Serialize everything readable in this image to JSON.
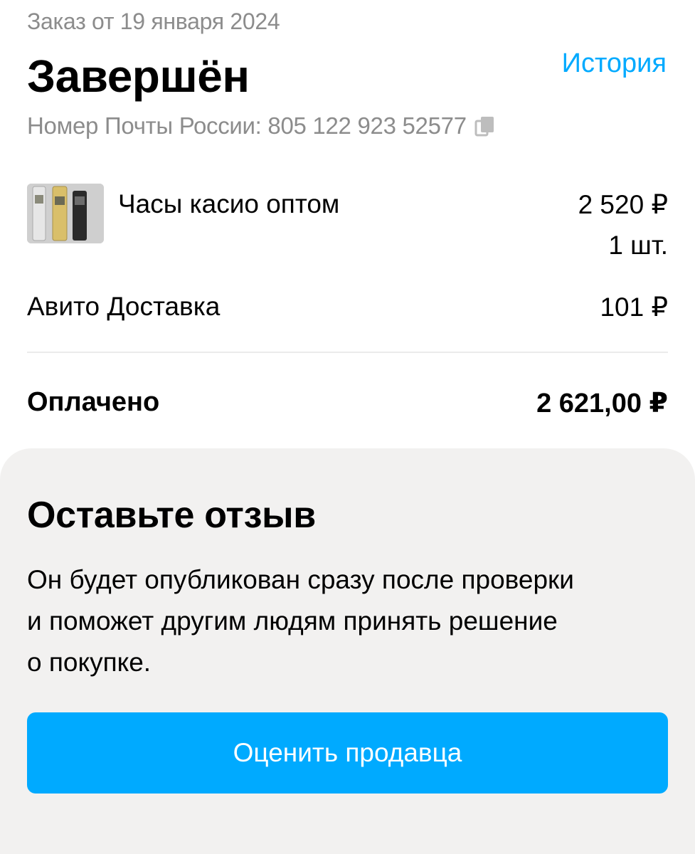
{
  "order": {
    "date_label": "Заказ от 19 января 2024",
    "status": "Завершён",
    "history_link": "История",
    "tracking_label": "Номер Почты России: 805 122 923 52577"
  },
  "product": {
    "title": "Часы касио оптом",
    "price": "2 520 ₽",
    "quantity": "1 шт."
  },
  "delivery": {
    "label": "Авито Доставка",
    "price": "101 ₽"
  },
  "total": {
    "label": "Оплачено",
    "amount": "2 621,00 ₽"
  },
  "review": {
    "title": "Оставьте отзыв",
    "line1": "Он будет опубликован сразу после проверки",
    "line2": "и поможет другим людям принять решение",
    "line3": "о покупке.",
    "button_label": "Оценить продавца"
  },
  "colors": {
    "accent": "#00aaff",
    "secondary_text": "#8c8c8c",
    "card_background": "#f2f1f0"
  },
  "icons": {
    "copy": "copy-icon",
    "thumbnail": "product-thumbnail"
  }
}
